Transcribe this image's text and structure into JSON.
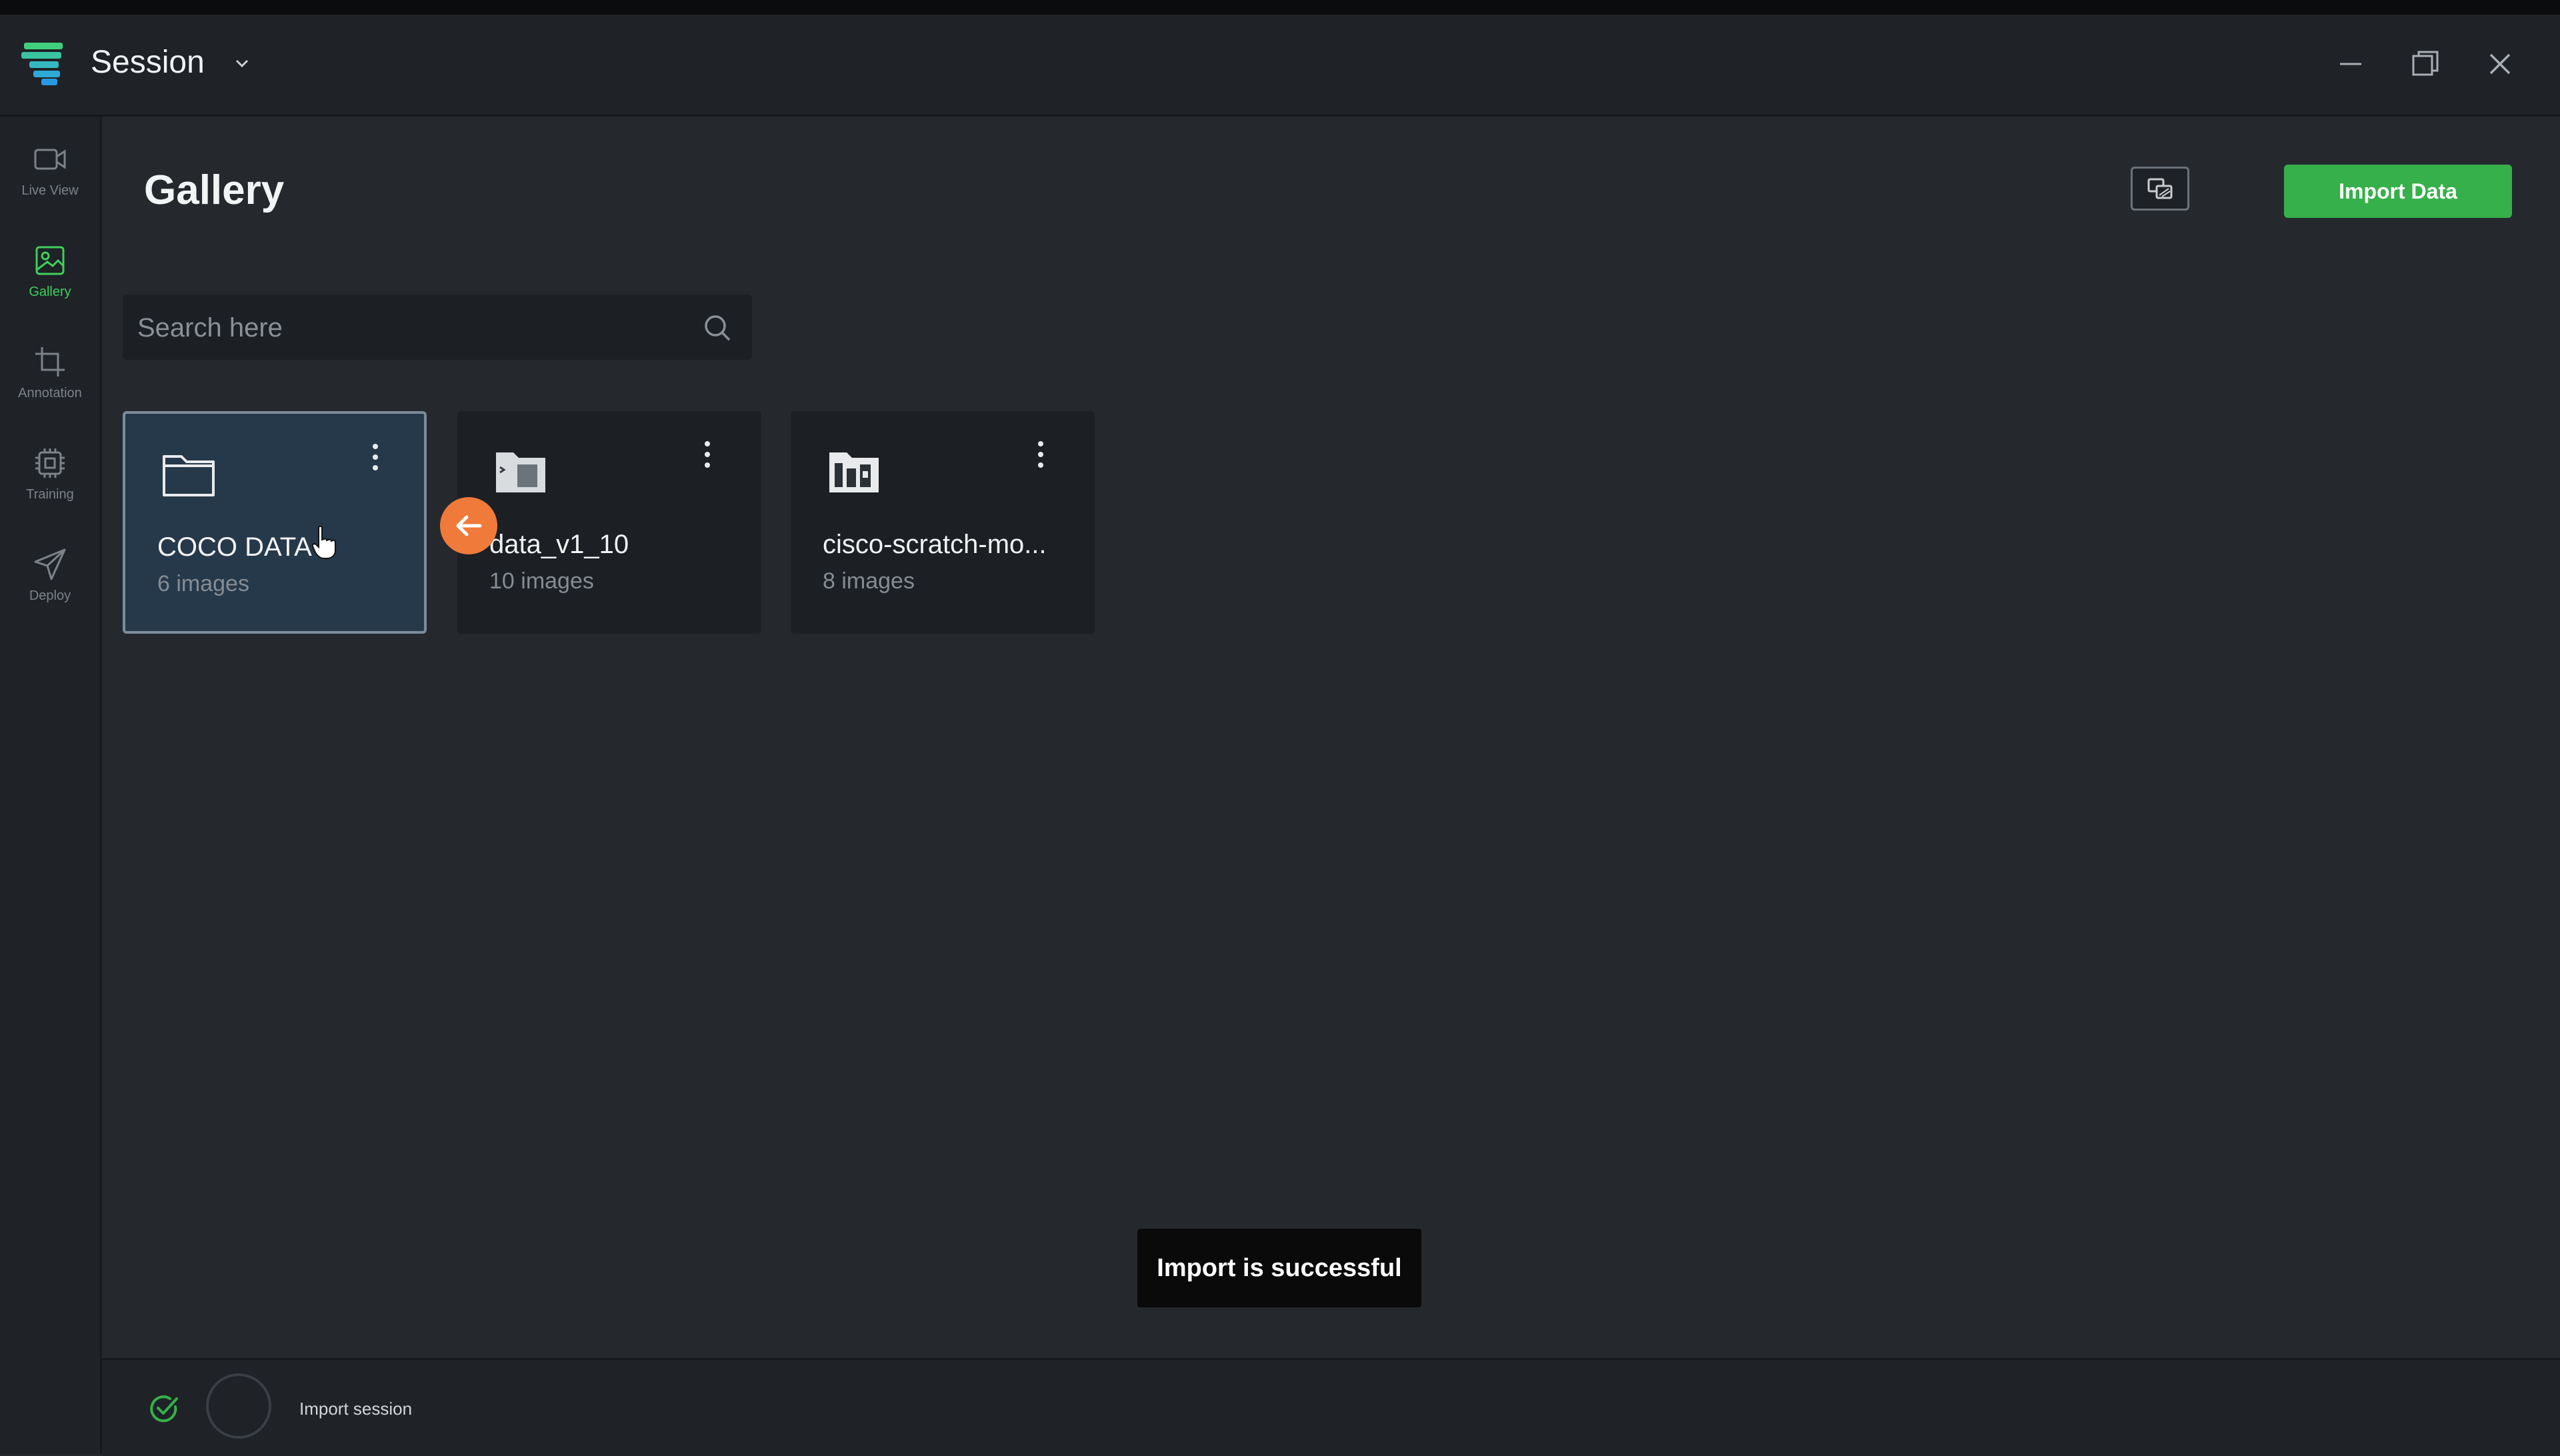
{
  "window": {
    "title": "Session",
    "controls": {
      "minimize": "minimize-icon",
      "maximize": "maximize-icon",
      "close": "close-icon"
    }
  },
  "sidebar": {
    "items": [
      {
        "label": "Live View",
        "icon": "video-camera-icon",
        "active": false
      },
      {
        "label": "Gallery",
        "icon": "image-icon",
        "active": true
      },
      {
        "label": "Annotation",
        "icon": "crop-icon",
        "active": false
      },
      {
        "label": "Training",
        "icon": "chip-icon",
        "active": false
      },
      {
        "label": "Deploy",
        "icon": "send-icon",
        "active": false
      }
    ]
  },
  "main": {
    "title": "Gallery",
    "import_label": "Import Data",
    "search": {
      "placeholder": "Search here",
      "value": ""
    },
    "datasets": [
      {
        "name": "COCO DATA",
        "count": "6 images",
        "selected": true
      },
      {
        "name": "data_v1_10",
        "count": "10 images",
        "selected": false
      },
      {
        "name": "cisco-scratch-mo...",
        "count": "8 images",
        "selected": false
      }
    ]
  },
  "toast": {
    "message": "Import is successful"
  },
  "footer": {
    "status_label": "Import session",
    "status_icon": "check-circle-icon"
  },
  "colors": {
    "accent": "#36b04a",
    "active_nav": "#3ecf5c",
    "badge": "#f07a3a",
    "background": "#25292d"
  }
}
